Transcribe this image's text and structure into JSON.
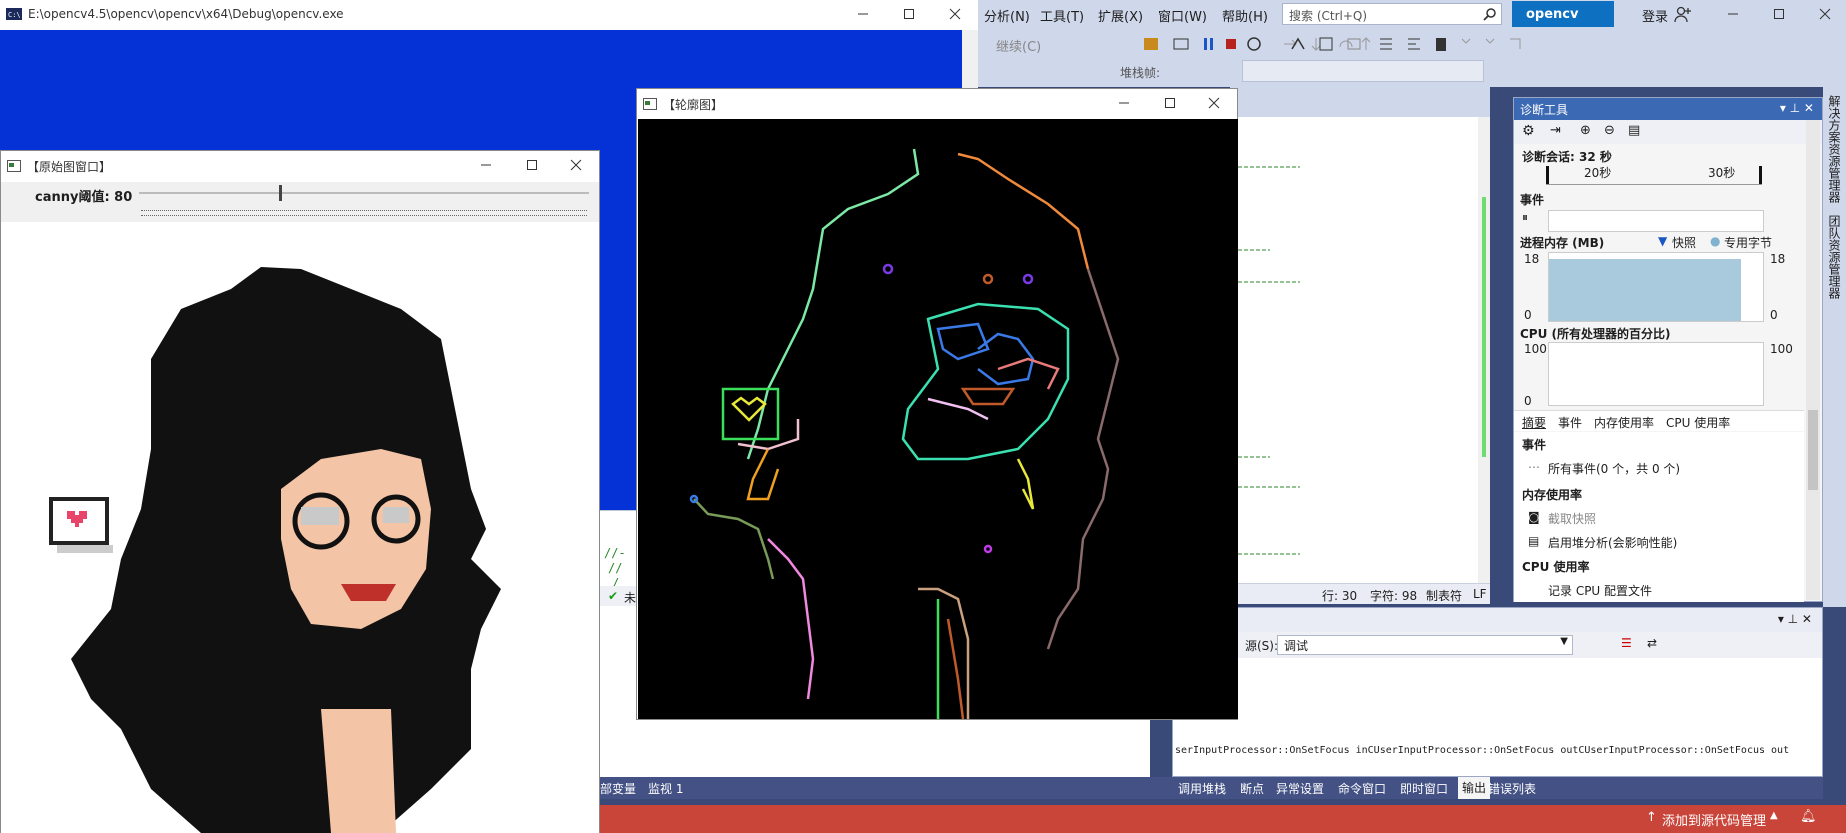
{
  "vs": {
    "menus": [
      "分析(N)",
      "工具(T)",
      "扩展(X)",
      "窗口(W)",
      "帮助(H)"
    ],
    "search_placeholder": "搜索 (Ctrl+Q)",
    "solution_name": "opencv",
    "login_label": "登录",
    "continue_label": "继续(C)",
    "stack_frame_label": "堆栈帧:",
    "editor_status": {
      "line": "行: 30",
      "char": "字符: 98",
      "tab": "制表符",
      "eol": "LF"
    },
    "code_fragment": [
      "//-",
      "//",
      "/"
    ],
    "editor_check": "未",
    "side_tabs": [
      "解决方案资源管理器",
      "团队资源管理器"
    ],
    "accent": "#0e70c0",
    "statusbar_color": "#c9453a"
  },
  "diag": {
    "title": "诊断工具",
    "session_label": "诊断会话: 32 秒",
    "timeline_ticks": [
      "20秒",
      "30秒"
    ],
    "events_label": "事件",
    "memory_label": "进程内存 (MB)",
    "snapshot_legend": "快照",
    "private_bytes_legend": "专用字节",
    "memory_max": "18",
    "memory_min": "0",
    "cpu_label": "CPU (所有处理器的百分比)",
    "cpu_max": "100",
    "cpu_min": "0",
    "tabs": [
      "摘要",
      "事件",
      "内存使用率",
      "CPU 使用率"
    ],
    "section_events": "事件",
    "all_events": "所有事件(0 个，共 0 个)",
    "section_memory": "内存使用率",
    "take_snapshot": "截取快照",
    "heap_profile": "启用堆分析(会影响性能)",
    "section_cpu": "CPU 使用率",
    "cpu_record": "记录 CPU 配置文件"
  },
  "output": {
    "source_label": "源(S):",
    "source_value": "调试",
    "log_line": "serInputProcessor::OnSetFocus inCUserInputProcessor::OnSetFocus outCUserInputProcessor::OnSetFocus out",
    "tabs": [
      "调用堆栈",
      "断点",
      "异常设置",
      "命令窗口",
      "即时窗口",
      "输出",
      "错误列表"
    ],
    "active_tab": "输出"
  },
  "locals_tabs": [
    "部变量",
    "监视 1"
  ],
  "statusbar": {
    "source_control": "添加到源代码管理"
  },
  "console": {
    "title": "E:\\opencv4.5\\opencv\\opencv\\x64\\Debug\\opencv.exe"
  },
  "orig_window": {
    "title": "【原始图窗口】",
    "trackbar_label": "canny阈值: 80",
    "trackbar_value": 80
  },
  "contour_window": {
    "title": "【轮廓图】"
  }
}
